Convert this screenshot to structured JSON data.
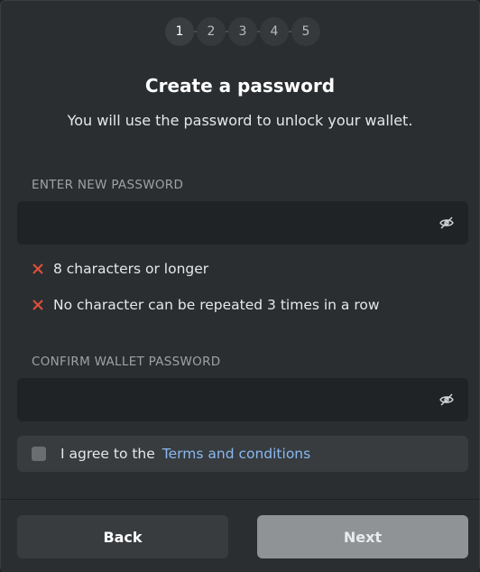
{
  "stepper": {
    "steps": [
      "1",
      "2",
      "3",
      "4",
      "5"
    ],
    "active": "1"
  },
  "header": {
    "title": "Create a password",
    "subtitle": "You will use the password to unlock your wallet."
  },
  "new_password": {
    "label": "ENTER NEW PASSWORD",
    "value": "",
    "visibility_icon": "eye-slash-icon"
  },
  "rules": [
    {
      "text": "8 characters or longer",
      "status": "unmet",
      "icon": "x-icon",
      "color": "#e0503a"
    },
    {
      "text": "No character can be repeated 3 times in a row",
      "status": "unmet",
      "icon": "x-icon",
      "color": "#e0503a"
    }
  ],
  "confirm_password": {
    "label": "CONFIRM WALLET PASSWORD",
    "value": "",
    "visibility_icon": "eye-slash-icon"
  },
  "agreement": {
    "prefix": "I agree to the",
    "link": "Terms and conditions",
    "checked": false,
    "link_color": "#8ab8f0"
  },
  "footer": {
    "back_label": "Back",
    "next_label": "Next"
  }
}
